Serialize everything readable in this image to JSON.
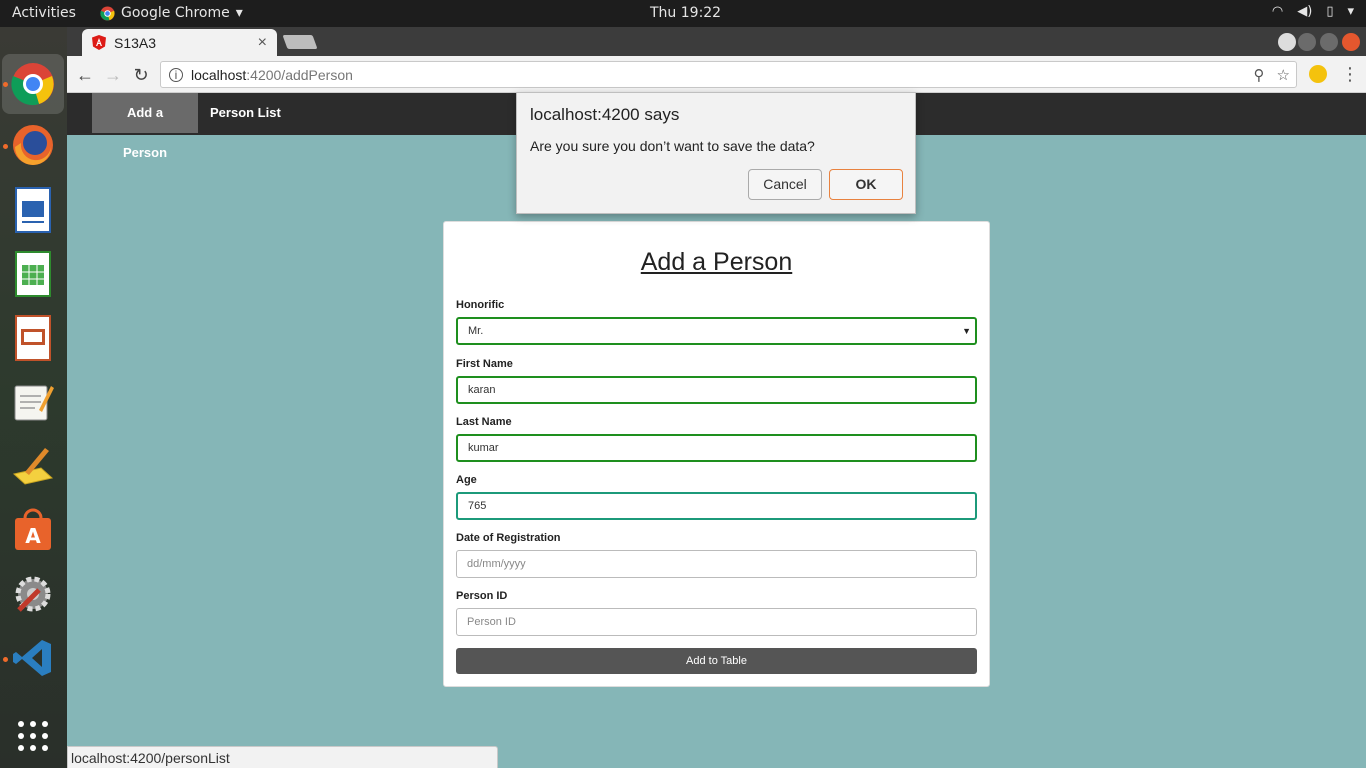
{
  "topbar": {
    "activities": "Activities",
    "app_name": "Google Chrome",
    "clock": "Thu 19:22"
  },
  "dock": {
    "items": [
      "chrome-icon",
      "firefox-icon",
      "writer-icon",
      "calc-icon",
      "impress-icon",
      "text-editor-icon",
      "notes-icon",
      "software-center-icon",
      "settings-icon",
      "vscode-icon",
      "app-grid-icon"
    ]
  },
  "browser": {
    "tab_title": "S13A3",
    "url_host": "localhost",
    "url_path": ":4200/addPerson",
    "status_url": "localhost:4200/personList"
  },
  "app": {
    "nav": [
      "Add a Person",
      "Person List"
    ],
    "form": {
      "title": "Add a Person",
      "honorific_label": "Honorific",
      "honorific_value": "Mr.",
      "first_name_label": "First Name",
      "first_name_value": "karan",
      "last_name_label": "Last Name",
      "last_name_value": "kumar",
      "age_label": "Age",
      "age_value": "765",
      "date_label": "Date of Registration",
      "date_placeholder": "dd/mm/yyyy",
      "person_id_label": "Person ID",
      "person_id_placeholder": "Person ID",
      "submit_label": "Add to Table"
    }
  },
  "dialog": {
    "title": "localhost:4200 says",
    "message": "Are you sure you don’t want to save the data?",
    "cancel_label": "Cancel",
    "ok_label": "OK"
  },
  "colors": {
    "page_bg": "#85b6b7",
    "valid_border": "#1e8f1e",
    "ok_border": "#e8823f",
    "nav_bg": "#2c2c2c"
  }
}
